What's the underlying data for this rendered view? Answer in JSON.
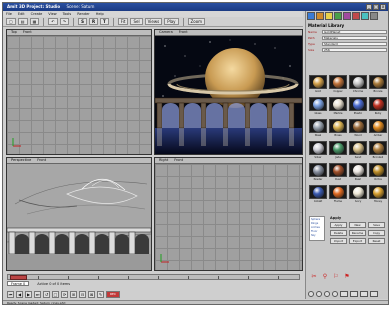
{
  "window": {
    "title": "Amit 3D Project: Studio",
    "scene": "Scene: Saturn",
    "controls": [
      "_",
      "□",
      "x"
    ]
  },
  "menu": [
    "File",
    "Edit",
    "Create",
    "View",
    "Tools",
    "Render",
    "Help"
  ],
  "toolbar": {
    "buttons": [
      "S",
      "R",
      "T",
      "Fit",
      "Sel",
      "Views",
      "Play"
    ],
    "zoom": "Zoom"
  },
  "viewports": {
    "top_left": {
      "labels": [
        "Top",
        "Front"
      ]
    },
    "top_right": {
      "labels": [
        "Camera",
        "Front"
      ]
    },
    "bottom_left": {
      "labels": [
        "Perspective",
        "Front"
      ]
    },
    "bottom_right": {
      "labels": [
        "Right",
        "Front"
      ]
    }
  },
  "timeline": {
    "frame": "0",
    "status": "Frame 0",
    "label": "Active 0 of 0 items"
  },
  "transport": {
    "buttons": [
      "⏮",
      "◀",
      "▶",
      "⏭",
      "↺",
      "□",
      "⟳",
      "⊞",
      "⊟",
      "⊠",
      "✎"
    ],
    "record": "REC"
  },
  "statusbar": {
    "text": "Ready. Scene loaded: Saturn_rings.a3d"
  },
  "right_panel": {
    "icons": [
      {
        "name": "material-icon",
        "color": "#3a7bd5"
      },
      {
        "name": "texture-icon",
        "color": "#d08a2a"
      },
      {
        "name": "light-icon",
        "color": "#e8d24a"
      },
      {
        "name": "camera-icon",
        "color": "#4aa04a"
      },
      {
        "name": "object-icon",
        "color": "#a04aa0"
      },
      {
        "name": "shader-icon",
        "color": "#c04a4a"
      },
      {
        "name": "env-icon",
        "color": "#4ac0c0"
      },
      {
        "name": "render-icon",
        "color": "#888888"
      }
    ],
    "title": "Material Library",
    "fields": [
      {
        "k": "Name",
        "v": "GoldPlanet"
      },
      {
        "k": "Path",
        "v": "Materials"
      },
      {
        "k": "Type",
        "v": "Standard"
      },
      {
        "k": "Size",
        "v": "256"
      }
    ],
    "materials": [
      {
        "name": "Gold",
        "color": "#d4a14a"
      },
      {
        "name": "Copper",
        "color": "#c0733a"
      },
      {
        "name": "Chrome",
        "color": "#c8c8c8"
      },
      {
        "name": "Bronze",
        "color": "#a97a3a"
      },
      {
        "name": "Glass",
        "color": "#7aa0e0"
      },
      {
        "name": "Marble",
        "color": "#e8e0d0"
      },
      {
        "name": "Plastic",
        "color": "#4a6ad0"
      },
      {
        "name": "Ruby",
        "color": "#c03020"
      },
      {
        "name": "Steel",
        "color": "#9aa4b0"
      },
      {
        "name": "Brass",
        "color": "#d8b050"
      },
      {
        "name": "Wood",
        "color": "#9a6a3a"
      },
      {
        "name": "Amber",
        "color": "#e08a20"
      },
      {
        "name": "Silver",
        "color": "#d0d0d8"
      },
      {
        "name": "Jade",
        "color": "#4a9a6a"
      },
      {
        "name": "Sand",
        "color": "#d8c08a"
      },
      {
        "name": "Bronze2",
        "color": "#b08040"
      },
      {
        "name": "Pewter",
        "color": "#8890a0"
      },
      {
        "name": "Rust",
        "color": "#a0502a"
      },
      {
        "name": "Pearl",
        "color": "#ece6e0"
      },
      {
        "name": "Ochre",
        "color": "#c0902a"
      },
      {
        "name": "Cobalt",
        "color": "#3a5ab0"
      },
      {
        "name": "Flame",
        "color": "#e06a20"
      },
      {
        "name": "Ivory",
        "color": "#f0ead8"
      },
      {
        "name": "Honey",
        "color": "#d8a030"
      }
    ],
    "list": [
      "Sphere",
      "Rings",
      "Arches",
      "Floor",
      "Sky"
    ],
    "sub_title": "Apply",
    "sub_buttons": [
      "Apply",
      "New",
      "Save",
      "Delete",
      "Rename",
      "Copy",
      "Import",
      "Export",
      "Reset"
    ],
    "tools": [
      "✂",
      "⚲",
      "⚐",
      "⚑"
    ],
    "foot": [
      "●",
      "●",
      "●",
      "●",
      "▭",
      "▭",
      "▭",
      "▭"
    ]
  }
}
